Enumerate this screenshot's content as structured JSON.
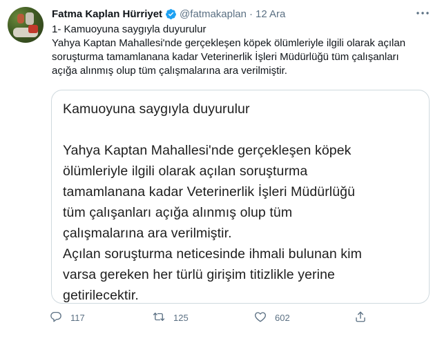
{
  "user": {
    "name": "Fatma Kaplan Hürriyet",
    "handle": "@fatmakaplan",
    "separator": "·",
    "date": "12 Ara"
  },
  "tweet_text": {
    "line1": "1- Kamuoyuna saygıyla duyurulur",
    "line2": "Yahya Kaptan Mahallesi'nde gerçekleşen köpek ölümleriyle ilgili olarak açılan",
    "line3": "soruşturma tamamlanana kadar Veterinerlik İşleri Müdürlüğü tüm çalışanları",
    "line4": "açığa alınmış olup tüm çalışmalarına ara verilmiştir."
  },
  "card": {
    "title": "Kamuoyuna saygıyla duyurulur",
    "lines": [
      "Yahya Kaptan Mahallesi'nde gerçekleşen köpek",
      "ölümleriyle ilgili olarak açılan soruşturma",
      "tamamlanana kadar Veterinerlik İşleri Müdürlüğü",
      "tüm çalışanları açığa alınmış olup tüm",
      "çalışmalarına ara verilmiştir.",
      "Açılan soruşturma neticesinde ihmali bulunan kim",
      "varsa gereken her türlü girişim titizlikle yerine",
      "getirilecektir."
    ]
  },
  "actions": {
    "replies": "117",
    "retweets": "125",
    "likes": "602"
  },
  "icons": {
    "verified": "verified-badge-icon",
    "more": "more-icon",
    "reply": "reply-icon",
    "retweet": "retweet-icon",
    "like": "heart-icon",
    "share": "share-icon"
  },
  "colors": {
    "accent": "#1da1f2",
    "muted": "#5b7083",
    "border": "#cfd9de"
  }
}
